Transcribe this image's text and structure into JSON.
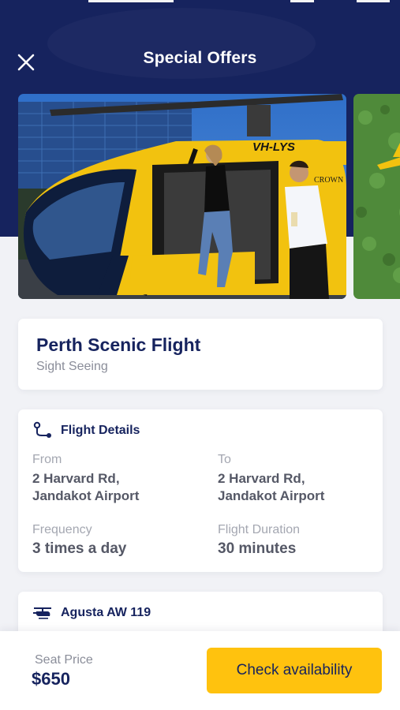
{
  "header": {
    "title": "Special Offers",
    "close_icon": "close-icon"
  },
  "carousel": {
    "main_image": {
      "registration": "VH-LYS",
      "crown_logo": "CROWN",
      "subject": "helicopter-photo"
    },
    "next_image": {
      "subject": "helicopter-grass-photo"
    }
  },
  "offer": {
    "title": "Perth Scenic Flight",
    "category": "Sight Seeing"
  },
  "flight_details": {
    "heading": "Flight Details",
    "icon": "route-icon",
    "from_label": "From",
    "from_line1": "2 Harvard Rd,",
    "from_line2": "Jandakot Airport",
    "to_label": "To",
    "to_line1": "2 Harvard Rd,",
    "to_line2": "Jandakot Airport",
    "frequency_label": "Frequency",
    "frequency_value": "3 times a day",
    "duration_label": "Flight Duration",
    "duration_value": "30 minutes"
  },
  "aircraft": {
    "icon": "helicopter-icon",
    "name": "Agusta AW 119"
  },
  "footer": {
    "price_label": "Seat Price",
    "price_value": "$650",
    "cta_label": "Check availability"
  },
  "colors": {
    "navy": "#16235e",
    "accent": "#ffc20e",
    "muted": "#8a8d99"
  }
}
